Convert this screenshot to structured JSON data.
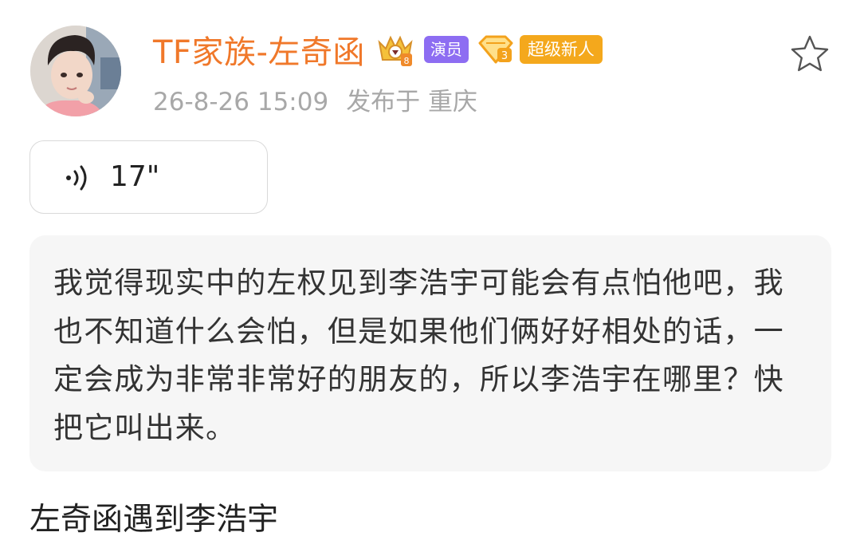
{
  "post": {
    "author": {
      "name": "TF家族-左奇函",
      "avatar_icon": "avatar-photo",
      "badges": {
        "crown_icon": "crown-badge-icon",
        "crown_level": "8",
        "actor_label": "演员",
        "level_icon": "diamond-level-icon",
        "level_value": "3",
        "newbie_label": "超级新人"
      }
    },
    "timestamp": "26-8-26 15:09",
    "location": "发布于 重庆",
    "favorite_icon": "star-outline-icon"
  },
  "voice": {
    "icon": "voice-wave-icon",
    "duration": "17\""
  },
  "quote": {
    "text": "我觉得现实中的左权见到李浩宇可能会有点怕他吧，我也不知道什么会怕，但是如果他们俩好好相处的话，一定会成为非常非常好的朋友的，所以李浩宇在哪里？快把它叫出来。"
  },
  "caption": "左奇函遇到李浩宇",
  "colors": {
    "name": "#f0782a",
    "actor_badge": "#8d6df2",
    "newbie_badge": "#f4a81c",
    "meta": "#a8a8a8",
    "quote_bg": "#f6f6f6"
  }
}
